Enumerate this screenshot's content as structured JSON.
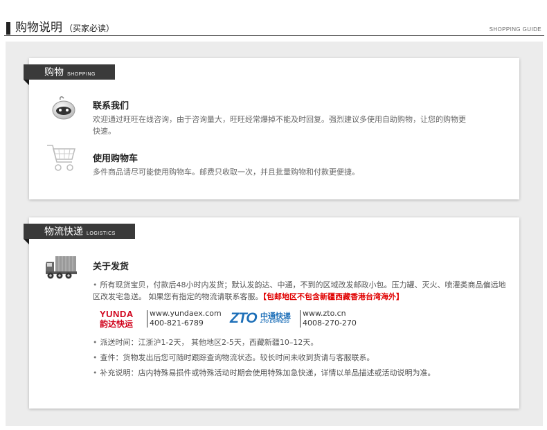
{
  "header": {
    "title": "购物说明",
    "subtitle": "（买家必读）",
    "english": "SHOPPING GUIDE"
  },
  "shopping": {
    "tag_cn": "购物",
    "tag_en": "SHOPPING",
    "items": [
      {
        "title": "联系我们",
        "desc": "欢迎通过旺旺在线咨询，由于咨询量大，旺旺经常爆掉不能及时回复。强烈建议多使用自助购物，让您的购物更快速。",
        "icon": "wangwang-chat-icon"
      },
      {
        "title": "使用购物车",
        "desc": "多件商品请尽可能使用购物车。邮费只收取一次，并且批量购物和付款更便捷。",
        "icon": "shopping-cart-icon"
      }
    ]
  },
  "logistics": {
    "tag_cn": "物流快递",
    "tag_en": "LOGISTICS",
    "title": "关于发货",
    "icon": "delivery-truck-icon",
    "bullet1": "所有现货宝贝，付款后48小时内发货；默认发韵达、中通，不到的区域改发邮政小包。压力罐、灭火、喷灌类商品偏远地区改发宅急送。 如果您有指定的物流请联系客服。",
    "bullet1_highlight": "【包邮地区不包含新疆西藏香港台湾海外】",
    "couriers": [
      {
        "logo_top": "YUNDA",
        "logo_bottom": "韵达快运",
        "url": "www.yundaex.com",
        "phone": "400-821-6789"
      },
      {
        "logo_top": "ZTO",
        "logo_cn": "中通快递",
        "logo_en": "ZTO EXPRESS",
        "url": "www.zto.cn",
        "phone": "4008-270-270"
      }
    ],
    "bullet2": "派送时间：江浙沪1-2天， 其他地区2-5天，西藏新疆10–12天。",
    "bullet3": "查件：货物发出后您可随时跟踪查询物流状态。较长时间未收到货请与客服联系。",
    "bullet4": "补充说明：店内特殊易损件或特殊活动时期会使用特殊加急快递，详情以单品描述或活动说明为准。"
  },
  "colors": {
    "tag_bg": "#3a3a3a",
    "highlight_red": "#e00000",
    "yunda_red": "#d0021b",
    "zto_blue": "#1d6fb8"
  }
}
